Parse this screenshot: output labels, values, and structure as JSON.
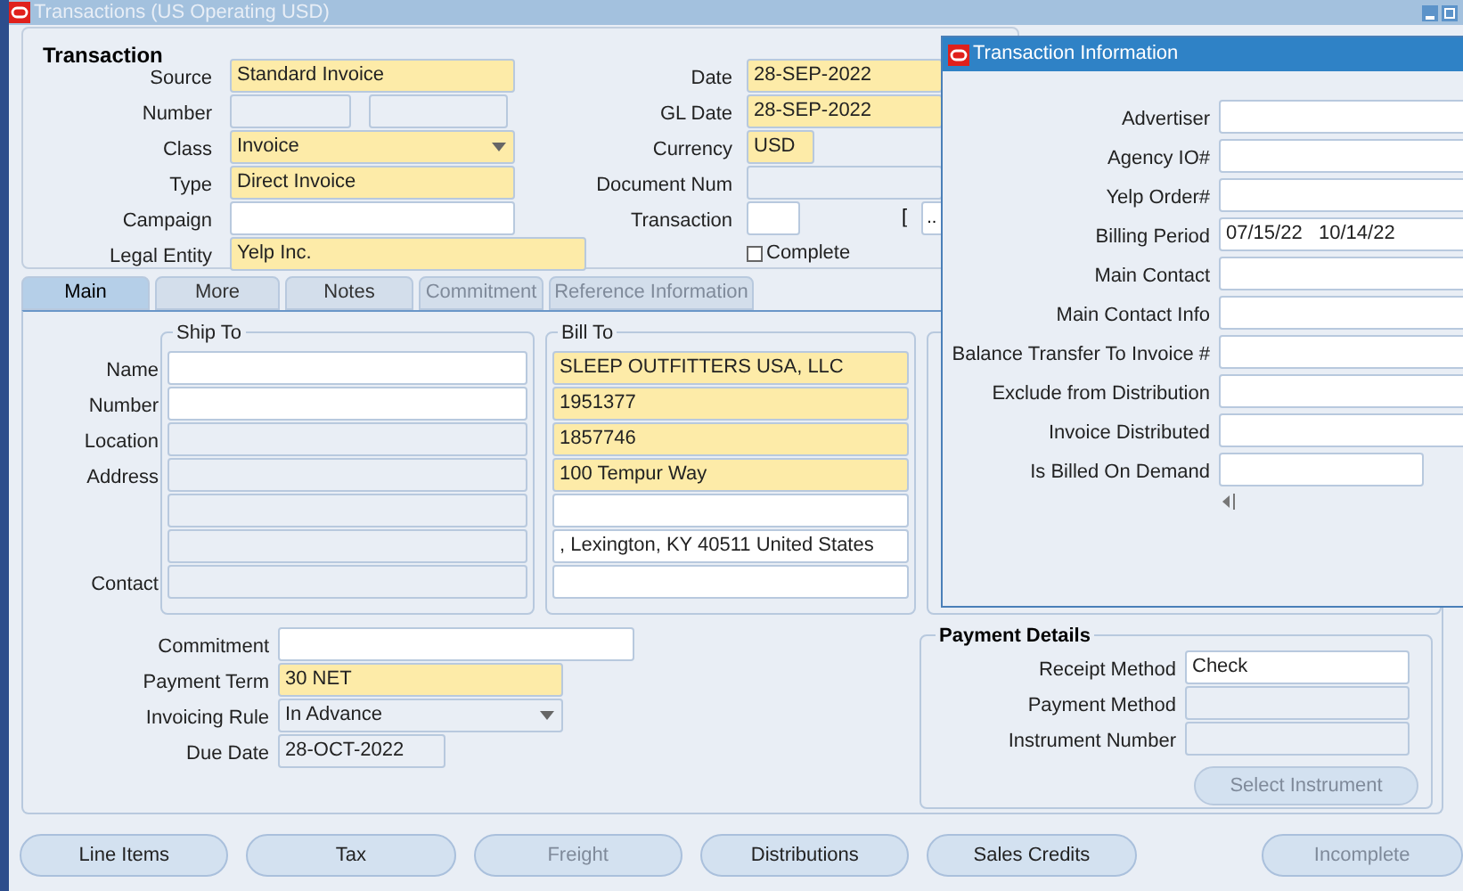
{
  "window": {
    "title": "Transactions (US Operating USD)"
  },
  "transaction": {
    "heading": "Transaction",
    "left_fields": [
      {
        "label": "Source",
        "value": "Standard Invoice",
        "kind": "required"
      },
      {
        "label": "Number",
        "kind": "split"
      },
      {
        "label": "Class",
        "value": "Invoice",
        "kind": "select"
      },
      {
        "label": "Type",
        "value": "Direct Invoice",
        "kind": "required"
      },
      {
        "label": "Campaign",
        "kind": "text"
      },
      {
        "label": "Legal Entity",
        "value": "Yelp Inc.",
        "kind": "required"
      }
    ],
    "right_fields": [
      {
        "label": "Date",
        "value": "28-SEP-2022",
        "kind": "required"
      },
      {
        "label": "GL Date",
        "value": "28-SEP-2022",
        "kind": "required"
      },
      {
        "label": "Currency",
        "value": "USD",
        "kind": "required"
      },
      {
        "label": "Document Num",
        "kind": "readonly"
      },
      {
        "label": "Transaction",
        "kind": "lookup",
        "bracket": "[",
        "button": ".."
      },
      {
        "label": "Complete",
        "kind": "checkbox",
        "checked": false
      }
    ]
  },
  "tabs": [
    {
      "label": "Main",
      "selected": true,
      "disabled": false
    },
    {
      "label": "More",
      "selected": false,
      "disabled": false
    },
    {
      "label": "Notes",
      "selected": false,
      "disabled": false
    },
    {
      "label": "Commitment",
      "selected": false,
      "disabled": true
    },
    {
      "label": "Reference Information",
      "selected": false,
      "disabled": true
    }
  ],
  "ship_to": {
    "heading": "Ship To",
    "rows": [
      {
        "label": "Name",
        "kind": "text"
      },
      {
        "label": "Number",
        "kind": "text"
      },
      {
        "label": "Location",
        "kind": "readonly"
      },
      {
        "label": "Address",
        "kind": "readonly"
      },
      {
        "kind": "readonly"
      },
      {
        "kind": "readonly"
      },
      {
        "label": "Contact",
        "kind": "readonly"
      }
    ]
  },
  "bill_to": {
    "heading": "Bill To",
    "rows": [
      {
        "value": "SLEEP OUTFITTERS USA, LLC",
        "kind": "required"
      },
      {
        "value": "1951377",
        "kind": "required"
      },
      {
        "value": "1857746",
        "kind": "required"
      },
      {
        "value": "100 Tempur Way",
        "kind": "required"
      },
      {
        "kind": "text"
      },
      {
        "value": ", Lexington, KY 40511 United States",
        "kind": "text"
      },
      {
        "kind": "text"
      }
    ]
  },
  "terms": [
    {
      "label": "Commitment",
      "kind": "text"
    },
    {
      "label": "Payment Term",
      "value": "30 NET",
      "kind": "required"
    },
    {
      "label": "Invoicing Rule",
      "value": "In Advance",
      "kind": "select"
    },
    {
      "label": "Due Date",
      "value": "28-OCT-2022",
      "kind": "readonly"
    }
  ],
  "payment_details": {
    "heading": "Payment Details",
    "fields": [
      {
        "label": "Receipt Method",
        "value": "Check",
        "kind": "text"
      },
      {
        "label": "Payment Method",
        "kind": "readonly"
      },
      {
        "label": "Instrument Number",
        "kind": "readonly"
      }
    ],
    "button": {
      "label": "Select Instrument",
      "disabled": true
    }
  },
  "buttons": [
    {
      "label": "Line Items",
      "disabled": false
    },
    {
      "label": "Tax",
      "disabled": false
    },
    {
      "label": "Freight",
      "disabled": true
    },
    {
      "label": "Distributions",
      "disabled": false
    },
    {
      "label": "Sales Credits",
      "disabled": false
    },
    {
      "label": "Incomplete",
      "disabled": true
    }
  ],
  "dialog": {
    "title": "Transaction Information",
    "fields": [
      {
        "label": "Advertiser",
        "kind": "text"
      },
      {
        "label": "Agency IO#",
        "kind": "text"
      },
      {
        "label": "Yelp Order#",
        "kind": "text"
      },
      {
        "label": "Billing Period",
        "value": "07/15/22   10/14/22",
        "kind": "text"
      },
      {
        "label": "Main Contact",
        "kind": "text"
      },
      {
        "label": "Main Contact Info",
        "kind": "text"
      },
      {
        "label": "Balance Transfer To Invoice #",
        "kind": "text"
      },
      {
        "label": "Exclude from Distribution",
        "kind": "text"
      },
      {
        "label": "Invoice Distributed",
        "kind": "text"
      },
      {
        "label": "Is Billed On Demand",
        "kind": "short"
      }
    ]
  }
}
